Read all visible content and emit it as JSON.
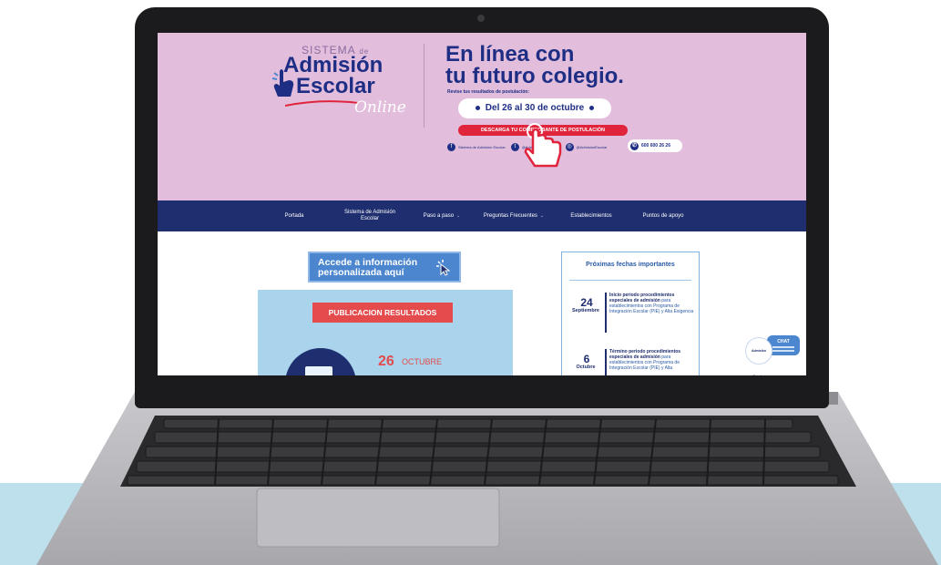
{
  "logo": {
    "top_word": "SISTEMA",
    "top_suffix": "de",
    "line1": "Admisión",
    "line2": "Escolar",
    "online": "Online"
  },
  "hero": {
    "title_line1": "En línea con",
    "title_line2": "tu futuro colegio.",
    "subtitle": "Revise tus resultados de postulación:",
    "date_range": "Del 26 al 30 de octubre",
    "download_label": "DESCARGA TU COMPROBANTE DE POSTULACIÓN",
    "social": {
      "facebook": "Sistema de Admisión Escolar",
      "twitter": "@AdmisionEscolar",
      "instagram": "@AdmisionEscolar",
      "phone": "600 600 26 26"
    }
  },
  "nav": {
    "items": [
      {
        "label": "Portada"
      },
      {
        "label": "Sistema de Admisión Escolar"
      },
      {
        "label": "Paso a paso"
      },
      {
        "label": "Preguntas Frecuentes"
      },
      {
        "label": "Establecimientos"
      },
      {
        "label": "Puntos de apoyo"
      }
    ]
  },
  "access": {
    "line1": "Accede a información",
    "line2": "personalizada aquí"
  },
  "result_card": {
    "banner": "PUBLICACION RESULTADOS",
    "day": "26",
    "month": "OCTUBRE"
  },
  "dates_panel": {
    "title": "Próximas fechas importantes",
    "events": [
      {
        "day": "24",
        "month": "Septiembre",
        "bold": "Inicio periodo procedimientos especiales de admisión",
        "text": "para establecimientos con Programa de Integración Escolar (PIE) y Alta Exigencia"
      },
      {
        "day": "6",
        "month": "Octubre",
        "bold": "Término periodo procedimientos especiales de admisión",
        "text": "para establecimientos con Programa de Integración Escolar (PIE) y Alta"
      }
    ]
  },
  "chat": {
    "label": "CHAT",
    "brand": "Admisión Escolar"
  },
  "colors": {
    "hero_bg": "#e2bedc",
    "brand_navy": "#1e2e6e",
    "accent_red": "#e0243c",
    "accent_blue": "#4b86cf",
    "bg_band": "#bde0ec"
  }
}
